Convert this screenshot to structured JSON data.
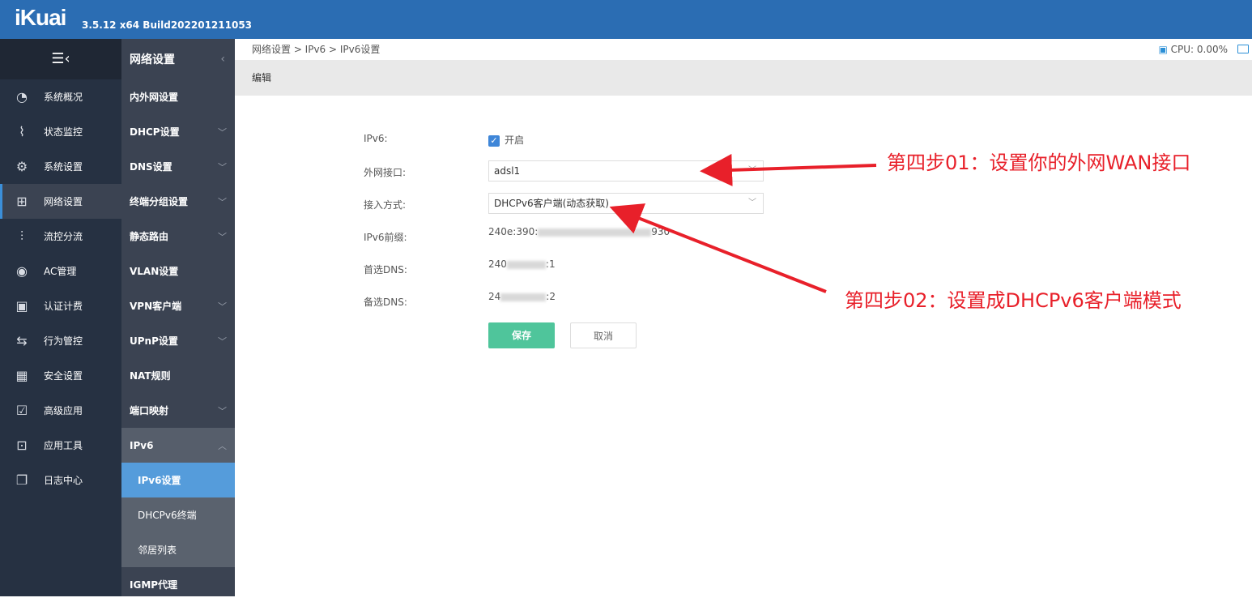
{
  "header": {
    "logo": "iKuai",
    "version": "3.5.12 x64 Build202201211053"
  },
  "nav1": {
    "toggle_icon": "☰‹",
    "items": [
      {
        "label": "系统概况",
        "icon": "◔"
      },
      {
        "label": "状态监控",
        "icon": "⌇"
      },
      {
        "label": "系统设置",
        "icon": "⚙"
      },
      {
        "label": "网络设置",
        "icon": "⊞"
      },
      {
        "label": "流控分流",
        "icon": "⫶"
      },
      {
        "label": "AC管理",
        "icon": "◉"
      },
      {
        "label": "认证计费",
        "icon": "▣"
      },
      {
        "label": "行为管控",
        "icon": "⇆"
      },
      {
        "label": "安全设置",
        "icon": "▦"
      },
      {
        "label": "高级应用",
        "icon": "☑"
      },
      {
        "label": "应用工具",
        "icon": "⊡"
      },
      {
        "label": "日志中心",
        "icon": "❐"
      }
    ]
  },
  "nav2": {
    "title": "网络设置",
    "items": [
      {
        "label": "内外网设置"
      },
      {
        "label": "DHCP设置"
      },
      {
        "label": "DNS设置"
      },
      {
        "label": "终端分组设置"
      },
      {
        "label": "静态路由"
      },
      {
        "label": "VLAN设置"
      },
      {
        "label": "VPN客户端"
      },
      {
        "label": "UPnP设置"
      },
      {
        "label": "NAT规则"
      },
      {
        "label": "端口映射"
      },
      {
        "label": "IPv6"
      }
    ],
    "sub": [
      {
        "label": "IPv6设置"
      },
      {
        "label": "DHCPv6终端"
      },
      {
        "label": "邻居列表"
      }
    ],
    "after": {
      "label": "IGMP代理"
    }
  },
  "breadcrumb": "网络设置 > IPv6 > IPv6设置",
  "cpu": "CPU: 0.00%",
  "page_title": "编辑",
  "form": {
    "ipv6_label": "IPv6:",
    "ipv6_enabled": true,
    "ipv6_text": "开启",
    "wan_label": "外网接口:",
    "wan_value": "adsl1",
    "mode_label": "接入方式:",
    "mode_value": "DHCPv6客户端(动态获取)",
    "prefix_label": "IPv6前缀:",
    "prefix_start": "240e:390:",
    "prefix_end": "930",
    "dns1_label": "首选DNS:",
    "dns1_start": "240",
    "dns1_end": ":1",
    "dns2_label": "备选DNS:",
    "dns2_start": "24",
    "dns2_end": ":2",
    "save": "保存",
    "cancel": "取消"
  },
  "annotations": {
    "step1": "第四步01：设置你的外网WAN接口",
    "step2": "第四步02：设置成DHCPv6客户端模式",
    "color": "#e8202a"
  }
}
